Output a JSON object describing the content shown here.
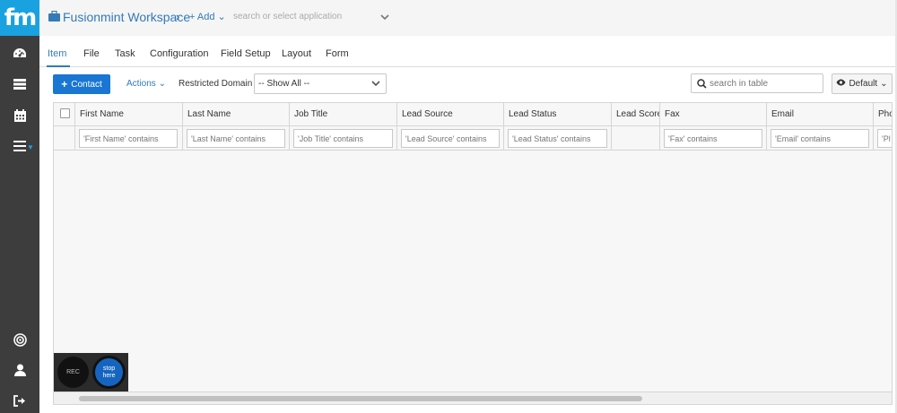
{
  "brand": {
    "logo": "fm",
    "accent": "#1aa1e0"
  },
  "topbar": {
    "workspace_title": "Fusionmint Workspace",
    "workspace_chevron": "›",
    "add_label": "+ Add",
    "add_caret": "⌄",
    "app_search_placeholder": "search or select application"
  },
  "sidebar": {
    "items": [
      {
        "icon": "dashboard-icon"
      },
      {
        "icon": "server-icon"
      },
      {
        "icon": "calendar-icon"
      },
      {
        "icon": "menu-icon"
      },
      {
        "icon": "target-icon"
      },
      {
        "icon": "user-icon"
      },
      {
        "icon": "sign-out-icon"
      }
    ]
  },
  "tabs": [
    "Item",
    "File",
    "Task",
    "Configuration",
    "Field Setup",
    "Layout",
    "Form"
  ],
  "toolbar": {
    "contact_label": "Contact",
    "contact_plus": "+",
    "actions_label": "Actions",
    "actions_caret": "⌄",
    "restricted_label": "Restricted Domain",
    "domain_value": "-- Show All --",
    "table_search_placeholder": "search in table",
    "default_label": "Default",
    "default_caret": "⌄"
  },
  "grid": {
    "columns": [
      "First Name",
      "Last Name",
      "Job Title",
      "Lead Source",
      "Lead Status",
      "Lead Score",
      "Fax",
      "Email",
      "Pho"
    ],
    "filters": [
      "'First Name' contains",
      "'Last Name' contains",
      "'Job Title' contains",
      "'Lead Source' contains",
      "'Lead Status' contains",
      "",
      "'Fax' contains",
      "'Email' contains",
      "'Pl"
    ]
  },
  "recorder": {
    "rec_label": "REC",
    "stop_label_1": "stop",
    "stop_label_2": "here"
  }
}
